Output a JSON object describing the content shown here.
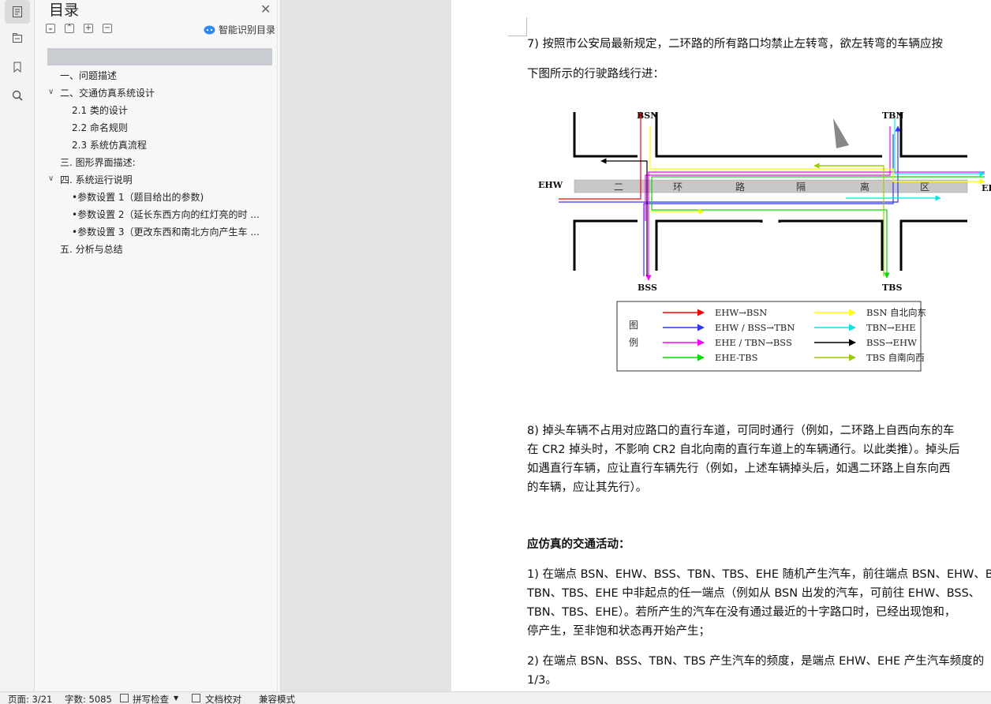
{
  "rail": {
    "icons": [
      "document-outline-icon",
      "structure-tree-icon",
      "bookmark-icon",
      "search-icon"
    ]
  },
  "toc": {
    "title": "目录",
    "smart_label": "智能识别目录",
    "items": [
      "一、问题描述",
      "二、交通仿真系统设计",
      "2.1 类的设计",
      "2.2 命名规则",
      "2.3 系统仿真流程",
      "三. 图形界面描述:",
      "四. 系统运行说明",
      "•参数设置 1（题目给出的参数)",
      "•参数设置 2（延长东西方向的红灯亮的时 ...",
      "•参数设置 3（更改东西和南北方向产生车 ...",
      "五. 分析与总结"
    ]
  },
  "doc": {
    "p7_line1": "7) 按照市公安局最新规定，二环路的所有路口均禁止左转弯，欲左转弯的车辆应按",
    "p7_line2": "下图所示的行驶路线行进：",
    "p8_line1": "8) 掉头车辆不占用对应路口的直行车道，可同时通行（例如，二环路上自西向东的车",
    "p8_line2": "在 CR2 掉头时，不影响 CR2 自北向南的直行车道上的车辆通行。以此类推）。掉头后",
    "p8_line3": "如遇直行车辆，应让直行车辆先行（例如，上述车辆掉头后，如遇二环路上自东向西",
    "p8_line4": "的车辆，应让其先行）。",
    "heading": "应仿真的交通活动：",
    "p1_line1": "1) 在端点 BSN、EHW、BSS、TBN、TBS、EHE 随机产生汽车，前往端点 BSN、EHW、B",
    "p1_line2": "TBN、TBS、EHE 中非起点的任一端点（例如从 BSN 出发的汽车，可前往 EHW、BSS、",
    "p1_line3": "TBN、TBS、EHE）。若所产生的汽车在没有通过最近的十字路口时，已经出现饱和，",
    "p1_line4": "停产生，至非饱和状态再开始产生；",
    "p2_line1": "2) 在端点 BSN、BSS、TBN、TBS 产生汽车的频度，是端点 EHW、EHE 产生汽车频度的",
    "p2_line2": "1/3。"
  },
  "figure": {
    "labels": {
      "bsn": "BSN",
      "tbn": "TBN",
      "ehw": "EHW",
      "ehe": "EH",
      "bss": "BSS",
      "tbs": "TBS"
    },
    "divider_chars": [
      "二",
      "环",
      "路",
      "隔",
      "离",
      "区"
    ],
    "legend_title": [
      "图",
      "例"
    ],
    "legend": [
      {
        "label": "EHW→BSN",
        "color": "#ff0000"
      },
      {
        "label": "EHW / BSS→TBN",
        "color": "#3333ff"
      },
      {
        "label": "EHE / TBN→BSS",
        "color": "#ff00ff"
      },
      {
        "label": "EHE-TBS",
        "color": "#00dd00"
      },
      {
        "label": "BSN 自北向东",
        "color": "#ffff00"
      },
      {
        "label": "TBN→EHE",
        "color": "#00e5e5"
      },
      {
        "label": "BSS→EHW",
        "color": "#000000"
      },
      {
        "label": "TBS 自南向西",
        "color": "#99cc00"
      }
    ]
  },
  "status": {
    "page": "页面: 3/21",
    "words": "字数: 5085",
    "spell": "拼写检查",
    "proof": "文档校对",
    "compat": "兼容模式"
  }
}
